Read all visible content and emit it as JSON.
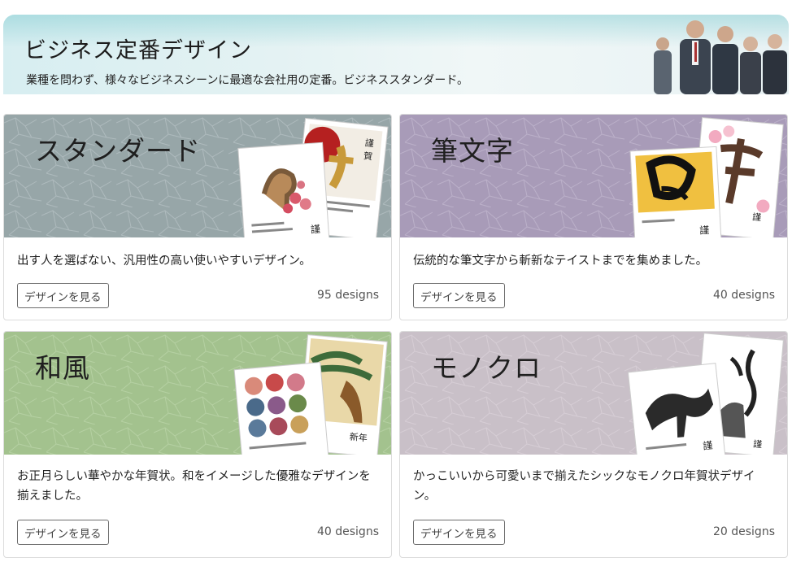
{
  "banner": {
    "title": "ビジネス定番デザイン",
    "subtitle": "業種を問わず、様々なビジネスシーンに最適な会社用の定番。ビジネススタンダード。"
  },
  "colors": {
    "standard_bg": "#97a6a8",
    "fude_bg": "#a89bb8",
    "wafu_bg": "#a3c28e",
    "mono_bg": "#c9c0c8"
  },
  "cards": [
    {
      "title": "スタンダード",
      "description": "出す人を選ばない、汎用性の高い使いやすいデザイン。",
      "button_label": "デザインを見る",
      "count": "95 designs"
    },
    {
      "title": "筆文字",
      "description": "伝統的な筆文字から斬新なテイストまでを集めました。",
      "button_label": "デザインを見る",
      "count": "40 designs"
    },
    {
      "title": "和風",
      "description": "お正月らしい華やかな年賀状。和をイメージした優雅なデザインを揃えました。",
      "button_label": "デザインを見る",
      "count": "40 designs"
    },
    {
      "title": "モノクロ",
      "description": "かっこいいから可愛いまで揃えたシックなモノクロ年賀状デザイン。",
      "button_label": "デザインを見る",
      "count": "20 designs"
    }
  ]
}
